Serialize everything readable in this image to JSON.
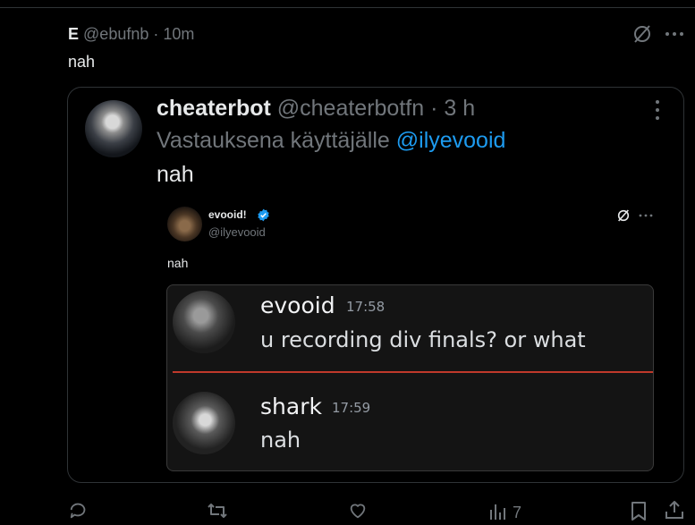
{
  "post": {
    "display_name": "E",
    "handle": "@ebufnb",
    "separator": "·",
    "time": "10m",
    "text": "nah"
  },
  "quoted_post": {
    "display_name": "cheaterbot",
    "handle": "@cheaterbotfn",
    "separator": "·",
    "time": "3 h",
    "reply_prefix": "Vastauksena käyttäjälle",
    "reply_mention": "@ilyevooid",
    "text": "nah"
  },
  "embedded_post": {
    "display_name": "evooid!",
    "handle": "@ilyevooid",
    "text": "nah",
    "verified": true
  },
  "chat_screenshot": {
    "accent_separator_color": "#c0392b",
    "messages": [
      {
        "author": "evooid",
        "time": "17:58",
        "text": "u recording div finals? or what"
      },
      {
        "author": "shark",
        "time": "17:59",
        "text": "nah"
      }
    ]
  },
  "actions": {
    "views_count": "7"
  },
  "icons": {
    "grok": "grok-icon",
    "more": "more-horizontal-icon",
    "more_vertical": "more-vertical-icon",
    "reply": "reply-icon",
    "repost": "repost-icon",
    "like": "heart-icon",
    "views": "views-icon",
    "bookmark": "bookmark-icon",
    "share": "share-icon"
  },
  "colors": {
    "background": "#000000",
    "text": "#e7e9ea",
    "muted": "#71767b",
    "mention": "#1d9bf0",
    "border": "#2f3336"
  }
}
